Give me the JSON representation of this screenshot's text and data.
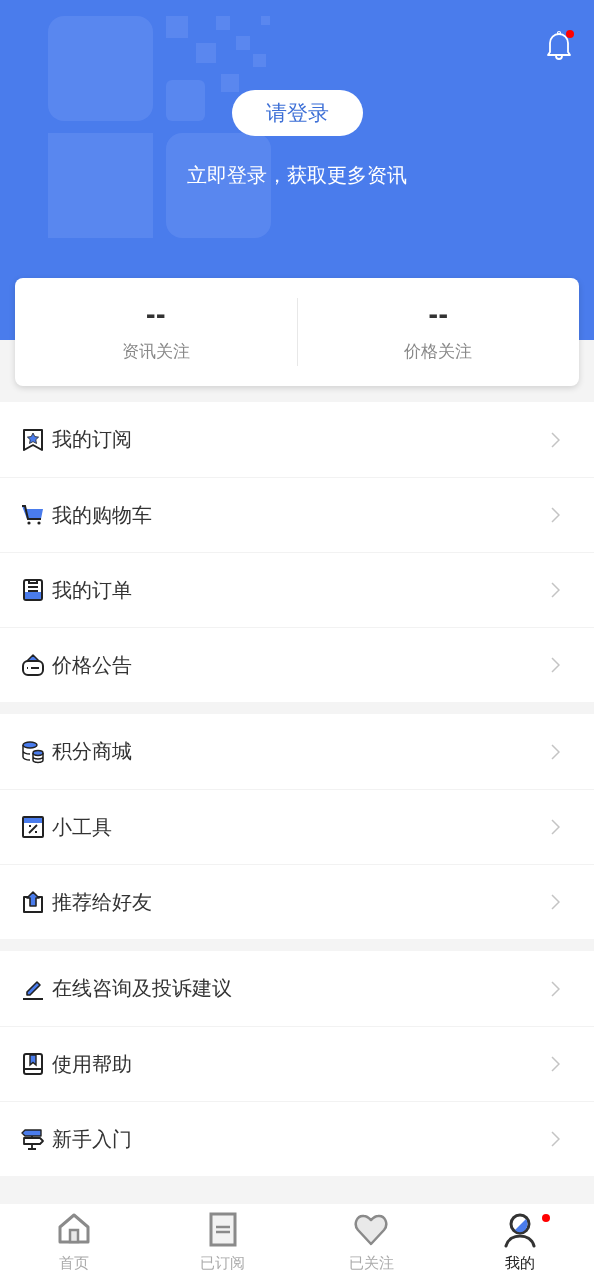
{
  "header": {
    "notification_badge": true,
    "login_button": "请登录",
    "subtitle": "立即登录，获取更多资讯"
  },
  "stats": [
    {
      "value": "--",
      "label": "资讯关注"
    },
    {
      "value": "--",
      "label": "价格关注"
    }
  ],
  "menu_groups": [
    {
      "items": [
        {
          "kind": "subscription",
          "label": "我的订阅"
        },
        {
          "kind": "cart",
          "label": "我的购物车"
        },
        {
          "kind": "order",
          "label": "我的订单"
        },
        {
          "kind": "notice",
          "label": "价格公告"
        }
      ]
    },
    {
      "items": [
        {
          "kind": "points",
          "label": "积分商城"
        },
        {
          "kind": "tools",
          "label": "小工具"
        },
        {
          "kind": "share",
          "label": "推荐给好友"
        }
      ]
    },
    {
      "items": [
        {
          "kind": "consult",
          "label": "在线咨询及投诉建议"
        },
        {
          "kind": "help",
          "label": "使用帮助"
        },
        {
          "kind": "guide",
          "label": "新手入门"
        }
      ]
    }
  ],
  "tab_bar": [
    {
      "kind": "home",
      "label": "首页",
      "selected": false,
      "badge": false
    },
    {
      "kind": "subscribed",
      "label": "已订阅",
      "selected": false,
      "badge": false
    },
    {
      "kind": "followed",
      "label": "已关注",
      "selected": false,
      "badge": false
    },
    {
      "kind": "mine",
      "label": "我的",
      "selected": true,
      "badge": true
    }
  ]
}
